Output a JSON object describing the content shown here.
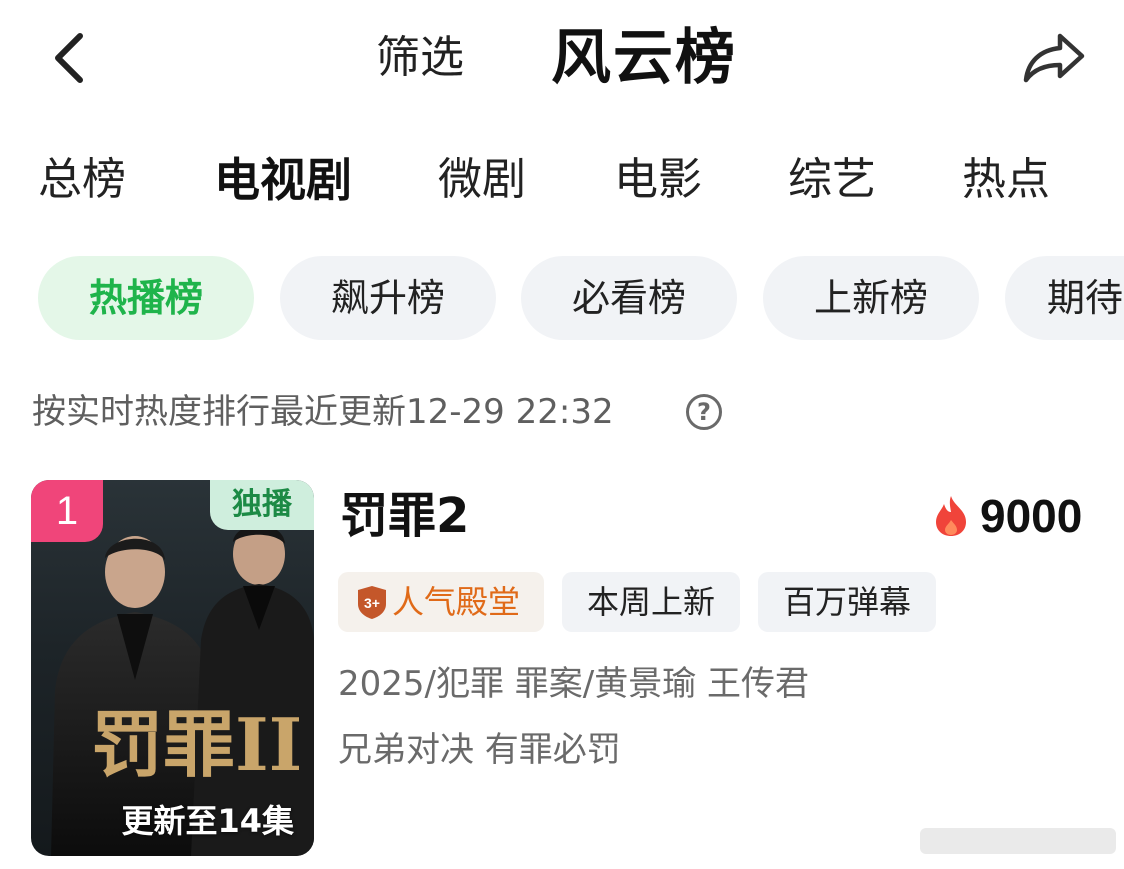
{
  "header": {
    "back_icon": "chevron-left-icon",
    "filter_label": "筛选",
    "title": "风云榜",
    "share_icon": "share-arrow-icon"
  },
  "category_tabs": [
    {
      "label": "总榜",
      "active": false
    },
    {
      "label": "电视剧",
      "active": true
    },
    {
      "label": "微剧",
      "active": false
    },
    {
      "label": "电影",
      "active": false
    },
    {
      "label": "综艺",
      "active": false
    },
    {
      "label": "热点",
      "active": false
    }
  ],
  "ranking_pills": [
    {
      "label": "热播榜",
      "active": true
    },
    {
      "label": "飙升榜",
      "active": false
    },
    {
      "label": "必看榜",
      "active": false
    },
    {
      "label": "上新榜",
      "active": false
    },
    {
      "label": "期待",
      "active": false
    }
  ],
  "update_info": {
    "text": "按实时热度排行最近更新12-29 22:32",
    "help_icon": "question-circle-icon",
    "help_glyph": "?"
  },
  "items": [
    {
      "rank": "1",
      "exclusive_badge": "独播",
      "episode_status": "更新至14集",
      "poster_logo_text": "罚罪II",
      "title": "罚罪2",
      "heat_icon": "flame-icon",
      "heat_value": "9000",
      "tags": [
        "人气殿堂",
        "本周上新",
        "百万弹幕"
      ],
      "hall_badge": "3+",
      "meta": "2025/犯罪 罪案/黄景瑜 王传君",
      "slogan": "兄弟对决 有罪必罚"
    }
  ],
  "colors": {
    "accent_green": "#1fb44b",
    "pill_active_bg": "#e4f7e8",
    "rank_badge": "#f0457a",
    "hall_orange": "#e06a18",
    "flame": "#f0443a"
  }
}
